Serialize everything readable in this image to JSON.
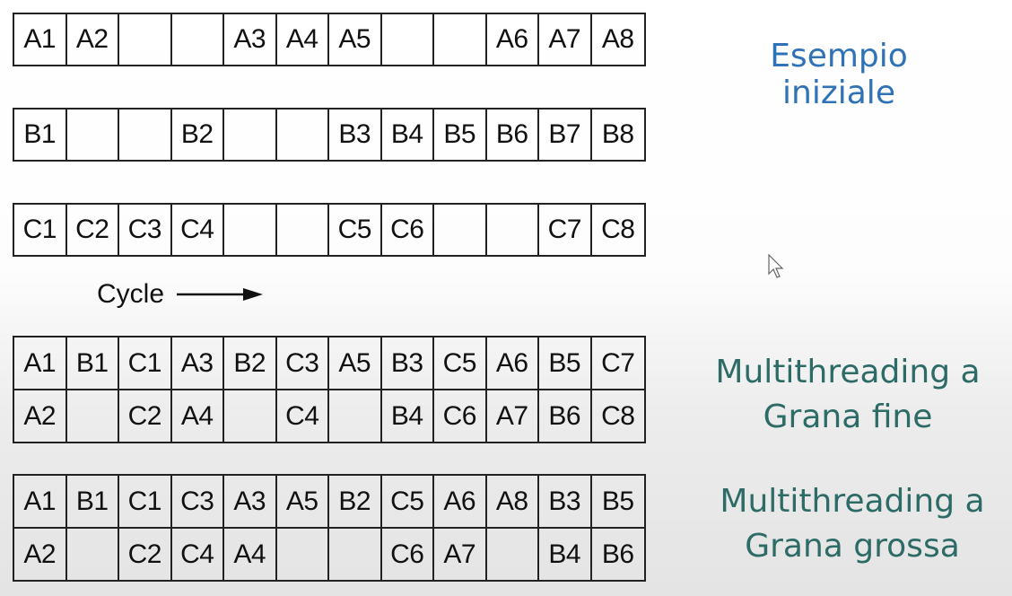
{
  "rows": {
    "a": [
      "A1",
      "A2",
      "",
      "",
      "A3",
      "A4",
      "A5",
      "",
      "",
      "A6",
      "A7",
      "A8"
    ],
    "b": [
      "B1",
      "",
      "",
      "B2",
      "",
      "",
      "B3",
      "B4",
      "B5",
      "B6",
      "B7",
      "B8"
    ],
    "c": [
      "C1",
      "C2",
      "C3",
      "C4",
      "",
      "",
      "C5",
      "C6",
      "",
      "",
      "C7",
      "C8"
    ]
  },
  "fine": {
    "top": [
      "A1",
      "B1",
      "C1",
      "A3",
      "B2",
      "C3",
      "A5",
      "B3",
      "C5",
      "A6",
      "B5",
      "C7"
    ],
    "bottom": [
      "A2",
      "",
      "C2",
      "A4",
      "",
      "C4",
      "",
      "B4",
      "C6",
      "A7",
      "B6",
      "C8"
    ]
  },
  "coarse": {
    "top": [
      "A1",
      "B1",
      "C1",
      "C3",
      "A3",
      "A5",
      "B2",
      "C5",
      "A6",
      "A8",
      "B3",
      "B5"
    ],
    "bottom": [
      "A2",
      "",
      "C2",
      "C4",
      "A4",
      "",
      "",
      "C6",
      "A7",
      "",
      "B4",
      "B6"
    ]
  },
  "labels": {
    "initial": "Esempio iniziale",
    "fine_line1": "Multithreading a",
    "fine_line2": "Grana fine",
    "coarse_line1": "Multithreading a",
    "coarse_line2": "Grana grossa",
    "cycle": "Cycle"
  },
  "colors": {
    "initial_label": "#2f72b5",
    "section_label": "#2d6b66"
  }
}
